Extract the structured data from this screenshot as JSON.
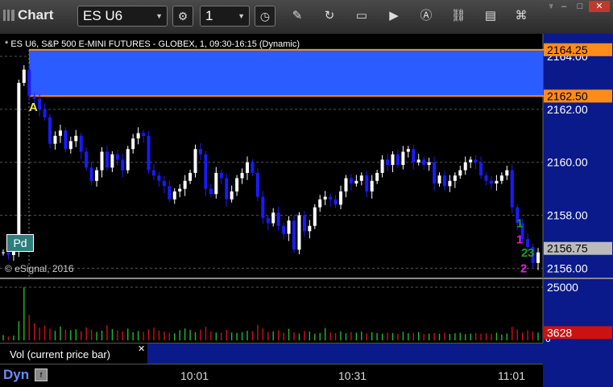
{
  "toolbar": {
    "title": "Chart",
    "symbol": "ES U6",
    "interval": "1"
  },
  "colors": {
    "price_panel_bg": "#000000",
    "axis_bg": "#0a1a8a",
    "band_fill": "#2a5cff",
    "band_border": "#ff8c1a",
    "up_bar": "#ffffff",
    "down_bar": "#1a1aff",
    "marker_yellow": "#e8e850",
    "marker_green": "#1e9e1e",
    "marker_magenta": "#e020e0",
    "volume_red": "#cc1111",
    "volume_green": "#22bb22"
  },
  "chart_data": [
    {
      "type": "candlestick",
      "title": "* ES U6, S&P 500 E-MINI FUTURES - GLOBEX, 1, 09:30-16:15 (Dynamic)",
      "ylim": [
        2155.8,
        2164.7
      ],
      "y_ticks": [
        "2164.00",
        "2162.00",
        "2160.00",
        "2158.00",
        "2156.00"
      ],
      "x_ticks": [
        "10:01",
        "10:31",
        "11:01"
      ],
      "band": {
        "upper": 2164.25,
        "lower": 2162.5,
        "upper_label": "2164.25",
        "lower_label": "2162.50"
      },
      "last_price": 2156.75,
      "last_price_label": "2156.75",
      "annotations": [
        "A",
        "1",
        "1",
        "2",
        "3",
        "2"
      ],
      "copyright": "© eSignal, 2016",
      "badge": "Pd",
      "closes": [
        2156.6,
        2156.5,
        2156.7,
        2163.0,
        2163.5,
        2162.5,
        2162.4,
        2162.0,
        2161.7,
        2160.7,
        2161.0,
        2161.2,
        2160.5,
        2160.8,
        2161.0,
        2160.4,
        2159.8,
        2159.3,
        2159.7,
        2160.4,
        2159.8,
        2160.3,
        2160.1,
        2159.7,
        2160.5,
        2160.9,
        2161.1,
        2161.0,
        2159.7,
        2159.5,
        2159.3,
        2159.1,
        2158.6,
        2158.9,
        2159.0,
        2159.3,
        2159.6,
        2160.5,
        2160.3,
        2159.0,
        2158.8,
        2159.6,
        2159.4,
        2158.6,
        2158.9,
        2159.4,
        2159.6,
        2160.0,
        2159.6,
        2158.7,
        2157.9,
        2157.7,
        2158.1,
        2157.6,
        2157.3,
        2157.8,
        2156.7,
        2158.0,
        2157.4,
        2157.6,
        2158.3,
        2158.6,
        2158.7,
        2158.6,
        2158.4,
        2158.9,
        2159.4,
        2159.2,
        2159.3,
        2159.5,
        2158.9,
        2159.3,
        2159.6,
        2160.1,
        2159.9,
        2160.3,
        2159.9,
        2160.4,
        2160.5,
        2160.0,
        2160.1,
        2159.9,
        2160.0,
        2159.2,
        2159.5,
        2159.1,
        2159.3,
        2159.5,
        2159.7,
        2160.0,
        2160.1,
        2160.0,
        2159.5,
        2159.3,
        2159.2,
        2159.3,
        2159.5,
        2159.7,
        2158.3,
        2157.7,
        2157.1,
        2156.8,
        2156.2,
        2156.6
      ],
      "volume": [
        2500,
        1800,
        2200,
        9000,
        25000,
        12000,
        8000,
        6000,
        7000,
        5500,
        4500,
        6500,
        5000,
        4800,
        5200,
        4300,
        6100,
        5000,
        3900,
        4600,
        7100,
        5300,
        4700,
        4200,
        5500,
        3800,
        4400,
        3900,
        5200,
        6000,
        4600,
        4100,
        3500,
        3300,
        4800,
        5600,
        4900,
        3800,
        5000,
        6400,
        4200,
        3700,
        3600,
        4900,
        3700,
        3500,
        3900,
        4500,
        4300,
        7300,
        5600,
        3900,
        4200,
        4700,
        3600,
        5400,
        3800,
        3200,
        4400,
        4100,
        3100,
        3500,
        5800,
        3700,
        3400,
        4200,
        3300,
        3900,
        3600,
        4100,
        3300,
        3800,
        3400,
        3200,
        3600,
        3400,
        3100,
        4000,
        3300,
        3500,
        3900,
        3000,
        3200,
        3400,
        3100,
        3600,
        3000,
        3300,
        3500,
        2900,
        3200,
        3400,
        3100,
        3300,
        3000,
        3600,
        2800,
        3200,
        6400,
        5200,
        3600,
        4800,
        4200,
        3628
      ],
      "vol_ylim": [
        0,
        25000
      ],
      "vol_ticks": [
        "25000",
        "0"
      ],
      "vol_last_label": "3628",
      "vol_panel_label": "Vol (current price bar)"
    }
  ],
  "bottom": {
    "dyn_label": "Dyn"
  }
}
